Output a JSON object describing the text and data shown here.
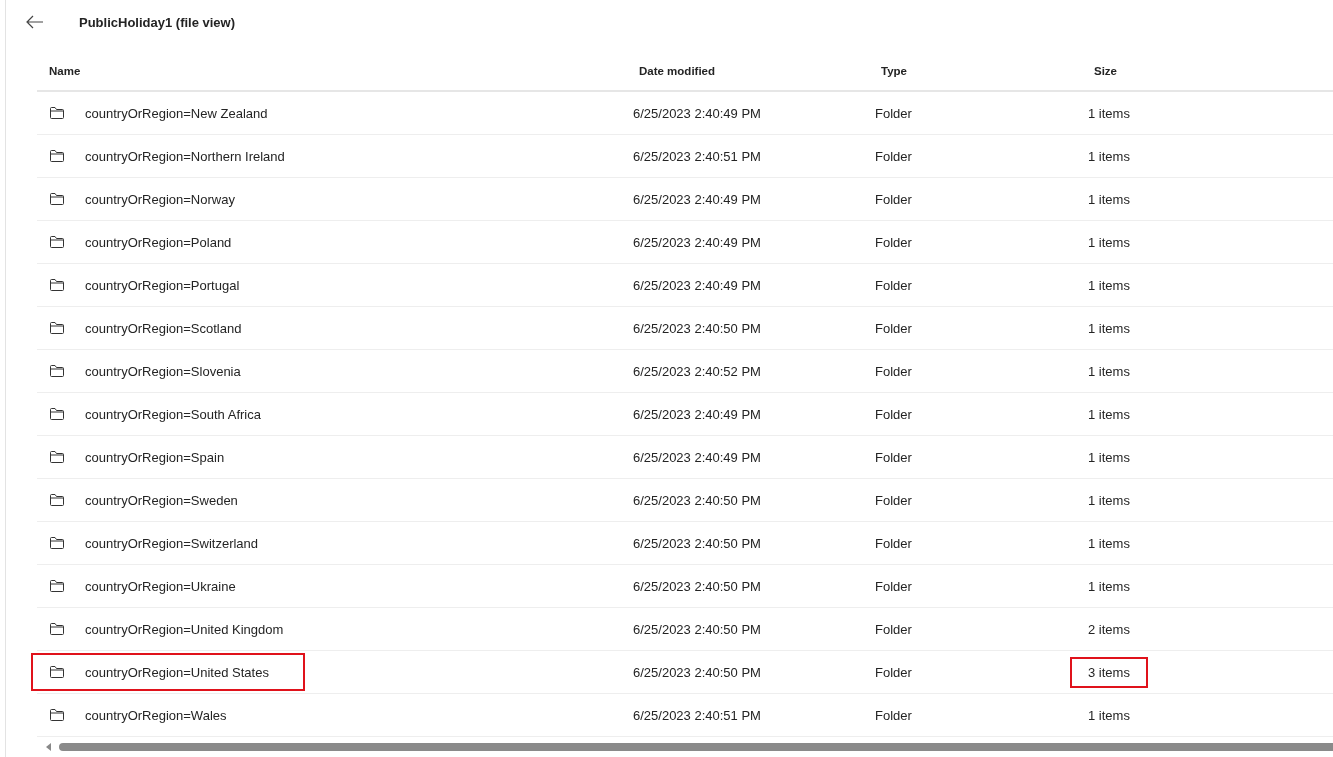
{
  "title": "PublicHoliday1 (file view)",
  "columns": [
    "Name",
    "Date modified",
    "Type",
    "Size"
  ],
  "rows": [
    {
      "name": "countryOrRegion=New Zealand",
      "modified": "6/25/2023 2:40:49 PM",
      "type": "Folder",
      "size": "1 items",
      "name_highlighted": false,
      "size_highlighted": false
    },
    {
      "name": "countryOrRegion=Northern Ireland",
      "modified": "6/25/2023 2:40:51 PM",
      "type": "Folder",
      "size": "1 items",
      "name_highlighted": false,
      "size_highlighted": false
    },
    {
      "name": "countryOrRegion=Norway",
      "modified": "6/25/2023 2:40:49 PM",
      "type": "Folder",
      "size": "1 items",
      "name_highlighted": false,
      "size_highlighted": false
    },
    {
      "name": "countryOrRegion=Poland",
      "modified": "6/25/2023 2:40:49 PM",
      "type": "Folder",
      "size": "1 items",
      "name_highlighted": false,
      "size_highlighted": false
    },
    {
      "name": "countryOrRegion=Portugal",
      "modified": "6/25/2023 2:40:49 PM",
      "type": "Folder",
      "size": "1 items",
      "name_highlighted": false,
      "size_highlighted": false
    },
    {
      "name": "countryOrRegion=Scotland",
      "modified": "6/25/2023 2:40:50 PM",
      "type": "Folder",
      "size": "1 items",
      "name_highlighted": false,
      "size_highlighted": false
    },
    {
      "name": "countryOrRegion=Slovenia",
      "modified": "6/25/2023 2:40:52 PM",
      "type": "Folder",
      "size": "1 items",
      "name_highlighted": false,
      "size_highlighted": false
    },
    {
      "name": "countryOrRegion=South Africa",
      "modified": "6/25/2023 2:40:49 PM",
      "type": "Folder",
      "size": "1 items",
      "name_highlighted": false,
      "size_highlighted": false
    },
    {
      "name": "countryOrRegion=Spain",
      "modified": "6/25/2023 2:40:49 PM",
      "type": "Folder",
      "size": "1 items",
      "name_highlighted": false,
      "size_highlighted": false
    },
    {
      "name": "countryOrRegion=Sweden",
      "modified": "6/25/2023 2:40:50 PM",
      "type": "Folder",
      "size": "1 items",
      "name_highlighted": false,
      "size_highlighted": false
    },
    {
      "name": "countryOrRegion=Switzerland",
      "modified": "6/25/2023 2:40:50 PM",
      "type": "Folder",
      "size": "1 items",
      "name_highlighted": false,
      "size_highlighted": false
    },
    {
      "name": "countryOrRegion=Ukraine",
      "modified": "6/25/2023 2:40:50 PM",
      "type": "Folder",
      "size": "1 items",
      "name_highlighted": false,
      "size_highlighted": false
    },
    {
      "name": "countryOrRegion=United Kingdom",
      "modified": "6/25/2023 2:40:50 PM",
      "type": "Folder",
      "size": "2 items",
      "name_highlighted": false,
      "size_highlighted": false
    },
    {
      "name": "countryOrRegion=United States",
      "modified": "6/25/2023 2:40:50 PM",
      "type": "Folder",
      "size": "3 items",
      "name_highlighted": true,
      "size_highlighted": true
    },
    {
      "name": "countryOrRegion=Wales",
      "modified": "6/25/2023 2:40:51 PM",
      "type": "Folder",
      "size": "1 items",
      "name_highlighted": false,
      "size_highlighted": false
    }
  ]
}
